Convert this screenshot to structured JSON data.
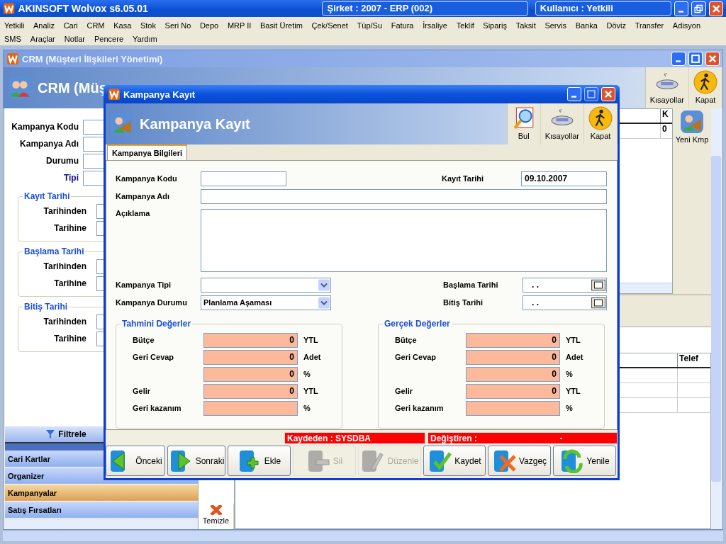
{
  "app": {
    "title": "AKINSOFT Wolvox s6.05.01",
    "company": "Şirket : 2007 - ERP (002)",
    "user": "Kullanıcı : Yetkili"
  },
  "menu_rows": [
    [
      "Yetkili",
      "Analiz",
      "Cari",
      "CRM",
      "Kasa",
      "Stok",
      "Seri No",
      "Depo",
      "MRP II",
      "Basit Üretim",
      "Çek/Senet",
      "Tüp/Su",
      "Fatura",
      "İrsaliye",
      "Teklif",
      "Sipariş",
      "Taksit",
      "Servis",
      "Banka",
      "Döviz",
      "Transfer",
      "Adisyon"
    ],
    [
      "SMS",
      "Araçlar",
      "Notlar",
      "Pencere",
      "Yardım"
    ]
  ],
  "crm_window": {
    "title": "CRM (Müşteri İlişkileri Yönetimi)",
    "header": "CRM (Müş",
    "toolbar": [
      {
        "label": "Kısayollar",
        "kind": "shortcuts"
      },
      {
        "label": "Kapat",
        "kind": "close"
      }
    ],
    "filter_fields": [
      {
        "label": "Kampanya Kodu",
        "kind": "plain"
      },
      {
        "label": "Kampanya Adı",
        "kind": "plain"
      },
      {
        "label": "Durumu",
        "kind": "plain"
      },
      {
        "label": "Tipi",
        "kind": "link"
      }
    ],
    "date_groups": [
      {
        "title": "Kayıt Tarihi",
        "rows": [
          "Tarihinden",
          "Tarihine"
        ]
      },
      {
        "title": "Başlama Tarihi",
        "rows": [
          "Tarihinden",
          "Tarihine"
        ]
      },
      {
        "title": "Bitiş Tarihi",
        "rows": [
          "Tarihinden",
          "Tarihine"
        ]
      }
    ],
    "filter_button": "Filtrele",
    "nav": [
      {
        "label": "Cari Kartlar",
        "selected": false
      },
      {
        "label": "Organizer",
        "selected": false
      },
      {
        "label": "Kampanyalar",
        "selected": true
      },
      {
        "label": "Satış Fırsatları",
        "selected": false
      }
    ],
    "top_grid": {
      "column": "K",
      "cell": "0"
    },
    "side_button": "Yeni Kmp",
    "clear_button": "Temizle",
    "bottom_grid": {
      "column": "Telef"
    }
  },
  "dialog": {
    "title": "Kampanya Kayıt",
    "header": "Kampanya Kayıt",
    "toolbar": [
      {
        "label": "Bul",
        "kind": "find"
      },
      {
        "label": "Kısayollar",
        "kind": "shortcuts"
      },
      {
        "label": "Kapat",
        "kind": "close"
      }
    ],
    "tabs": [
      {
        "label": "Kampanya Bilgileri",
        "selected": true
      }
    ],
    "form": {
      "code": {
        "label": "Kampanya Kodu"
      },
      "date": {
        "label": "Kayıt Tarihi",
        "value": "09.10.2007"
      },
      "name": {
        "label": "Kampanya Adı"
      },
      "desc": {
        "label": "Açıklama"
      },
      "type": {
        "label": "Kampanya Tipi"
      },
      "status": {
        "label": "Kampanya Durumu",
        "value": "Planlama Aşaması"
      },
      "start": {
        "label": "Başlama Tarihi",
        "value": ".  ."
      },
      "end": {
        "label": "Bitiş Tarihi",
        "value": ".  ."
      }
    },
    "groups": [
      {
        "title": "Tahmini Değerler",
        "rows": [
          {
            "label": "Bütçe",
            "value": "0",
            "unit": "YTL"
          },
          {
            "label": "Geri Cevap",
            "value": "0",
            "unit": "Adet"
          },
          {
            "value": "0",
            "unit": "%"
          },
          {
            "label": "Gelir",
            "value": "0",
            "unit": "YTL"
          },
          {
            "label": "Geri kazanım",
            "unit": "%"
          }
        ]
      },
      {
        "title": "Gerçek Değerler",
        "rows": [
          {
            "label": "Bütçe",
            "value": "0",
            "unit": "YTL"
          },
          {
            "label": "Geri Cevap",
            "value": "0",
            "unit": "Adet"
          },
          {
            "value": "0",
            "unit": "%"
          },
          {
            "label": "Gelir",
            "value": "0",
            "unit": "YTL"
          },
          {
            "label": "Geri kazanım",
            "unit": "%"
          }
        ]
      }
    ],
    "status": {
      "created_by": "Kaydeden : SYSDBA",
      "modified_by": "Değiştiren :",
      "modified_value": "-"
    },
    "buttons": [
      {
        "label": "Önceki",
        "kind": "prev",
        "disabled": false
      },
      {
        "label": "Sonraki",
        "kind": "next",
        "disabled": false
      },
      {
        "label": "Ekle",
        "kind": "add",
        "disabled": false
      },
      {
        "label": "Sil",
        "kind": "delete",
        "disabled": true
      },
      {
        "label": "Düzenle",
        "kind": "edit",
        "disabled": true
      },
      {
        "label": "Kaydet",
        "kind": "save",
        "disabled": false
      },
      {
        "label": "Vazgeç",
        "kind": "cancel",
        "disabled": false
      },
      {
        "label": "Yenile",
        "kind": "refresh",
        "disabled": false
      }
    ]
  }
}
